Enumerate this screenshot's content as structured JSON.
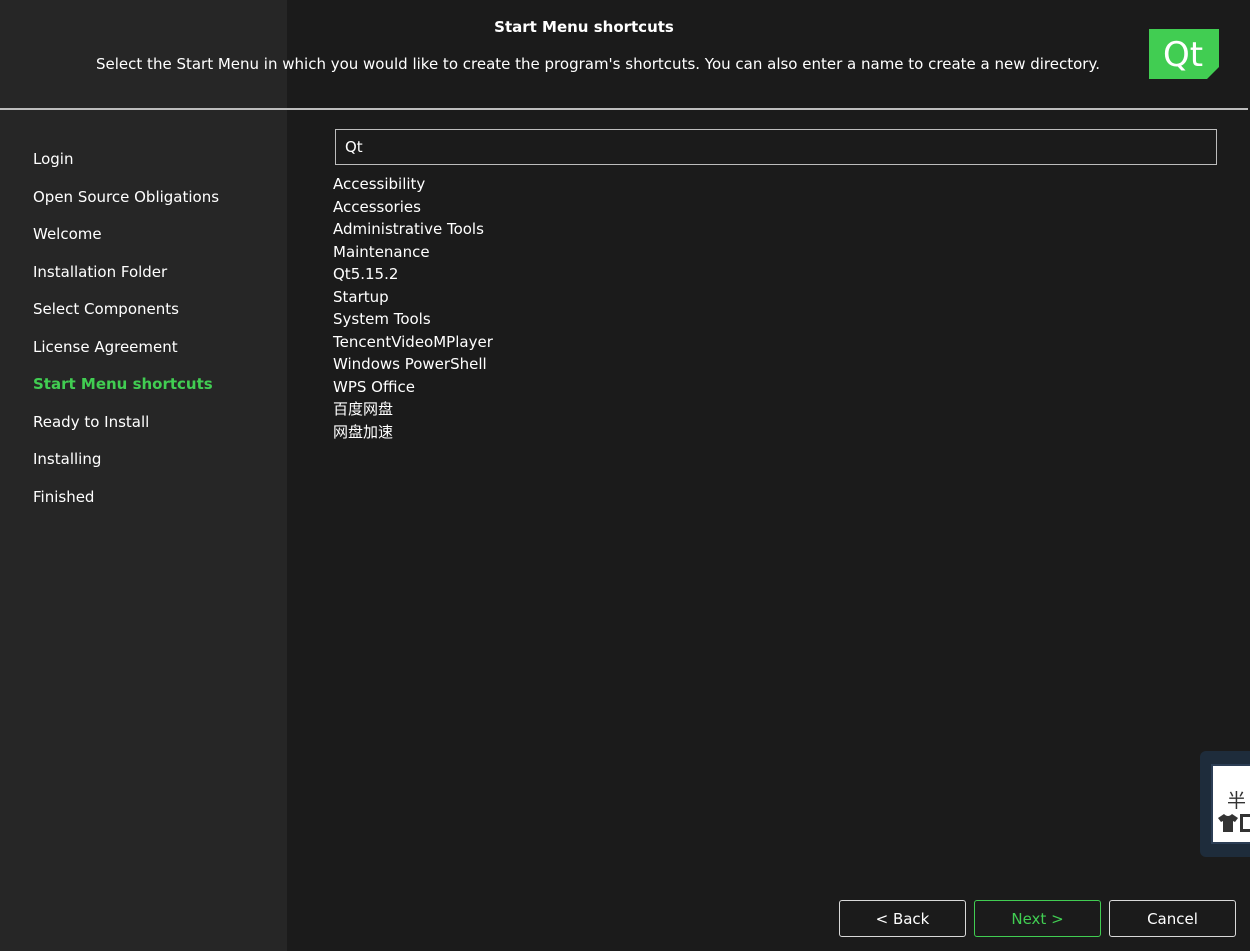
{
  "header": {
    "title": "Start Menu shortcuts",
    "subtitle": "Select the Start Menu in which you would like to create the program's shortcuts. You can also enter a name to create a new directory.",
    "logo_text": "Qt"
  },
  "sidebar": {
    "steps": [
      {
        "label": "Login",
        "active": false
      },
      {
        "label": "Open Source Obligations",
        "active": false
      },
      {
        "label": "Welcome",
        "active": false
      },
      {
        "label": "Installation Folder",
        "active": false
      },
      {
        "label": "Select Components",
        "active": false
      },
      {
        "label": "License Agreement",
        "active": false
      },
      {
        "label": "Start Menu shortcuts",
        "active": true
      },
      {
        "label": "Ready to Install",
        "active": false
      },
      {
        "label": "Installing",
        "active": false
      },
      {
        "label": "Finished",
        "active": false
      }
    ]
  },
  "main": {
    "directory_input": {
      "value": "Qt"
    },
    "folders": [
      "Accessibility",
      "Accessories",
      "Administrative Tools",
      "Maintenance",
      "Qt5.15.2",
      "Startup",
      "System Tools",
      "TencentVideoMPlayer",
      "Windows PowerShell",
      "WPS Office",
      "百度网盘",
      "网盘加速"
    ]
  },
  "ime_widget": {
    "char": "半"
  },
  "buttons": {
    "back": "< Back",
    "next": "Next >",
    "cancel": "Cancel"
  },
  "colors": {
    "accent": "#41cd52",
    "background": "#1b1b1b",
    "sidebar": "#262626"
  }
}
